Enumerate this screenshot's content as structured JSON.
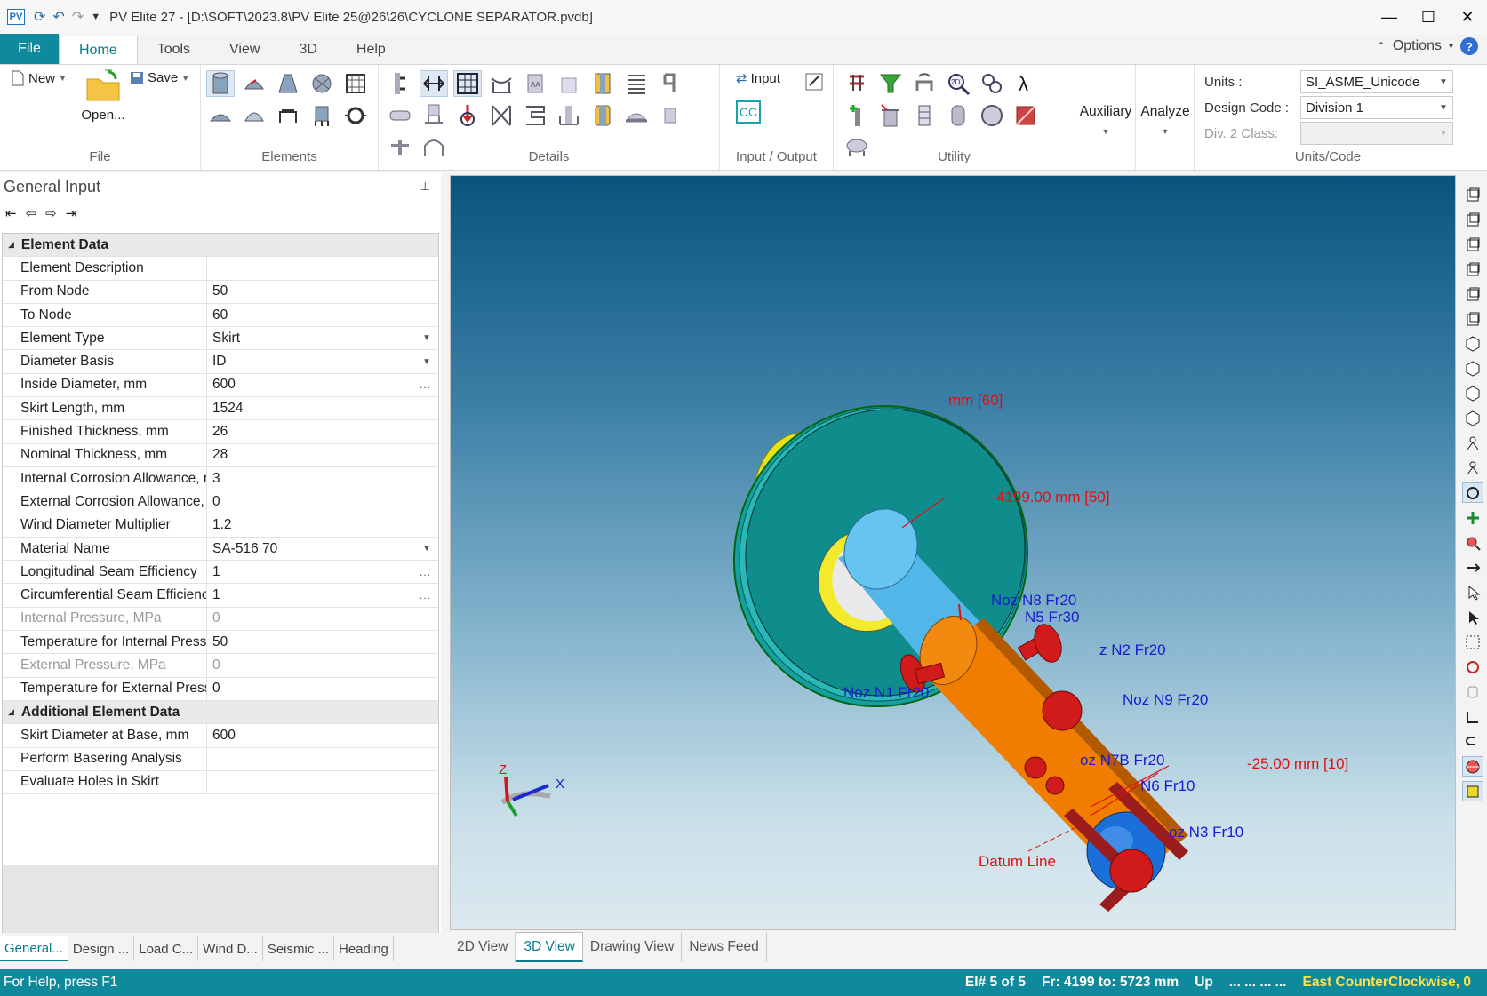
{
  "window": {
    "title": "PV Elite 27 - [D:\\SOFT\\2023.8\\PV Elite 25@26\\26\\CYCLONE SEPARATOR.pvdb]",
    "app_badge": "PV",
    "controls": {
      "minimize": "—",
      "maximize": "☐",
      "close": "✕"
    }
  },
  "ribbon_tabs": {
    "file": "File",
    "tabs": [
      "Home",
      "Tools",
      "View",
      "3D",
      "Help"
    ],
    "options": "Options",
    "help_badge": "?"
  },
  "ribbon": {
    "file_group": {
      "new": "New",
      "open": "Open...",
      "save": "Save",
      "label": "File"
    },
    "elements_label": "Elements",
    "details_label": "Details",
    "io": {
      "input": "Input",
      "cc": "CC",
      "label": "Input / Output"
    },
    "utility_label": "Utility",
    "auxiliary": "Auxiliary",
    "analyze": "Analyze",
    "units": {
      "units_label": "Units :",
      "units_value": "SI_ASME_Unicode",
      "code_label": "Design Code :",
      "code_value": "Division 1",
      "div2_label": "Div. 2 Class:",
      "div2_value": "",
      "group_label": "Units/Code"
    }
  },
  "general_input": {
    "title": "General Input",
    "pin": "📌",
    "nav": {
      "first": "⇤",
      "prev": "⇦",
      "next": "⇨",
      "last": "⇥"
    },
    "categories": {
      "element": "Element Data",
      "additional": "Additional Element Data"
    },
    "rows": [
      {
        "label": "Element Description",
        "value": ""
      },
      {
        "label": "From Node",
        "value": "50"
      },
      {
        "label": "To Node",
        "value": "60"
      },
      {
        "label": "Element Type",
        "value": "Skirt"
      },
      {
        "label": "Diameter Basis",
        "value": "ID"
      },
      {
        "label": "Inside Diameter, mm",
        "value": "600"
      },
      {
        "label": "Skirt Length, mm",
        "value": "1524"
      },
      {
        "label": "Finished Thickness, mm",
        "value": "26"
      },
      {
        "label": "Nominal Thickness, mm",
        "value": "28"
      },
      {
        "label": "Internal Corrosion Allowance, r",
        "value": "3"
      },
      {
        "label": "External Corrosion Allowance, r",
        "value": "0"
      },
      {
        "label": "Wind Diameter Multiplier",
        "value": "1.2"
      },
      {
        "label": "Material Name",
        "value": "SA-516 70"
      },
      {
        "label": "Longitudinal Seam Efficiency",
        "value": "1"
      },
      {
        "label": "Circumferential Seam Efficiency",
        "value": "1"
      },
      {
        "label": "Internal Pressure, MPa",
        "value": "0"
      },
      {
        "label": "Temperature for Internal Press",
        "value": "50"
      },
      {
        "label": "External Pressure, MPa",
        "value": "0"
      },
      {
        "label": "Temperature for External Press",
        "value": "0"
      }
    ],
    "additional_rows": [
      {
        "label": "Skirt Diameter at Base, mm",
        "value": "600"
      },
      {
        "label": "Perform Basering Analysis",
        "value": ""
      },
      {
        "label": "Evaluate Holes in Skirt",
        "value": ""
      }
    ]
  },
  "bottom_tabs": [
    "General...",
    "Design ...",
    "Load C...",
    "Wind D...",
    "Seismic ...",
    "Heading"
  ],
  "view_tabs": [
    "2D View",
    "3D View",
    "Drawing View",
    "News Feed"
  ],
  "viewport": {
    "labels": {
      "top_dim": "mm  [60]",
      "mid_dim": "4199.00 mm  [50]",
      "bot_dim": "-25.00 mm  [10]",
      "datum": "Datum Line",
      "n8": "Noz N8 Fr20",
      "n5": "N5 Fr30",
      "n2": "z N2 Fr20",
      "n1": "Noz N1 Fr20",
      "n9": "Noz N9 Fr20",
      "n7": "oz N7B Fr20",
      "n6": "N6 Fr10",
      "n3": "oz N3 Fr10"
    },
    "triad": {
      "x": "X",
      "z": "Z"
    },
    "colors": {
      "skirt": "#4fb3e6",
      "shell": "#f07d00",
      "basering": "#0f8c8c",
      "nozzle": "#cc1b1b",
      "label_red": "#e01010",
      "label_blue": "#1a1ad0"
    }
  },
  "status": {
    "help": "For Help, press F1",
    "element": "El# 5 of 5",
    "range": "Fr: 4199 to: 5723 mm",
    "up": "Up",
    "dots": "...  ...  ...  ...",
    "rotation": "East CounterClockwise, 0"
  }
}
